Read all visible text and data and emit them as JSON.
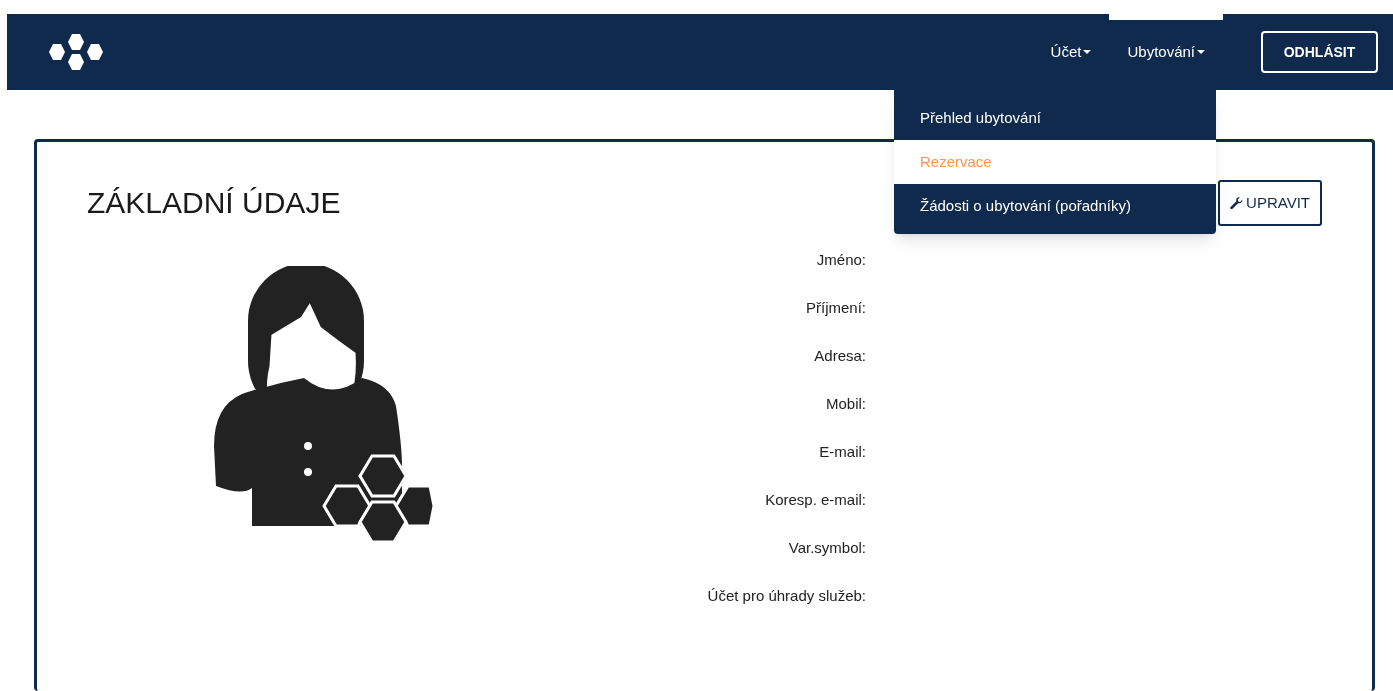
{
  "nav": {
    "items": [
      {
        "label": "Účet",
        "selected": false
      },
      {
        "label": "Ubytování",
        "selected": true
      }
    ],
    "logout": "ODHLÁSIT"
  },
  "dropdown": {
    "items": [
      {
        "label": "Přehled ubytování",
        "selected": false
      },
      {
        "label": "Rezervace",
        "selected": true
      },
      {
        "label": "Žádosti o ubytování (pořadníky)",
        "selected": false
      }
    ]
  },
  "profile": {
    "title": "ZÁKLADNÍ ÚDAJE",
    "edit_button": "UPRAVIT",
    "fields": [
      {
        "label": "Jméno:"
      },
      {
        "label": "Příjmení:"
      },
      {
        "label": "Adresa:"
      },
      {
        "label": "Mobil:"
      },
      {
        "label": "E-mail:"
      },
      {
        "label": "Koresp. e-mail:"
      },
      {
        "label": "Var.symbol:"
      },
      {
        "label": "Účet pro úhrady služeb:"
      }
    ]
  }
}
